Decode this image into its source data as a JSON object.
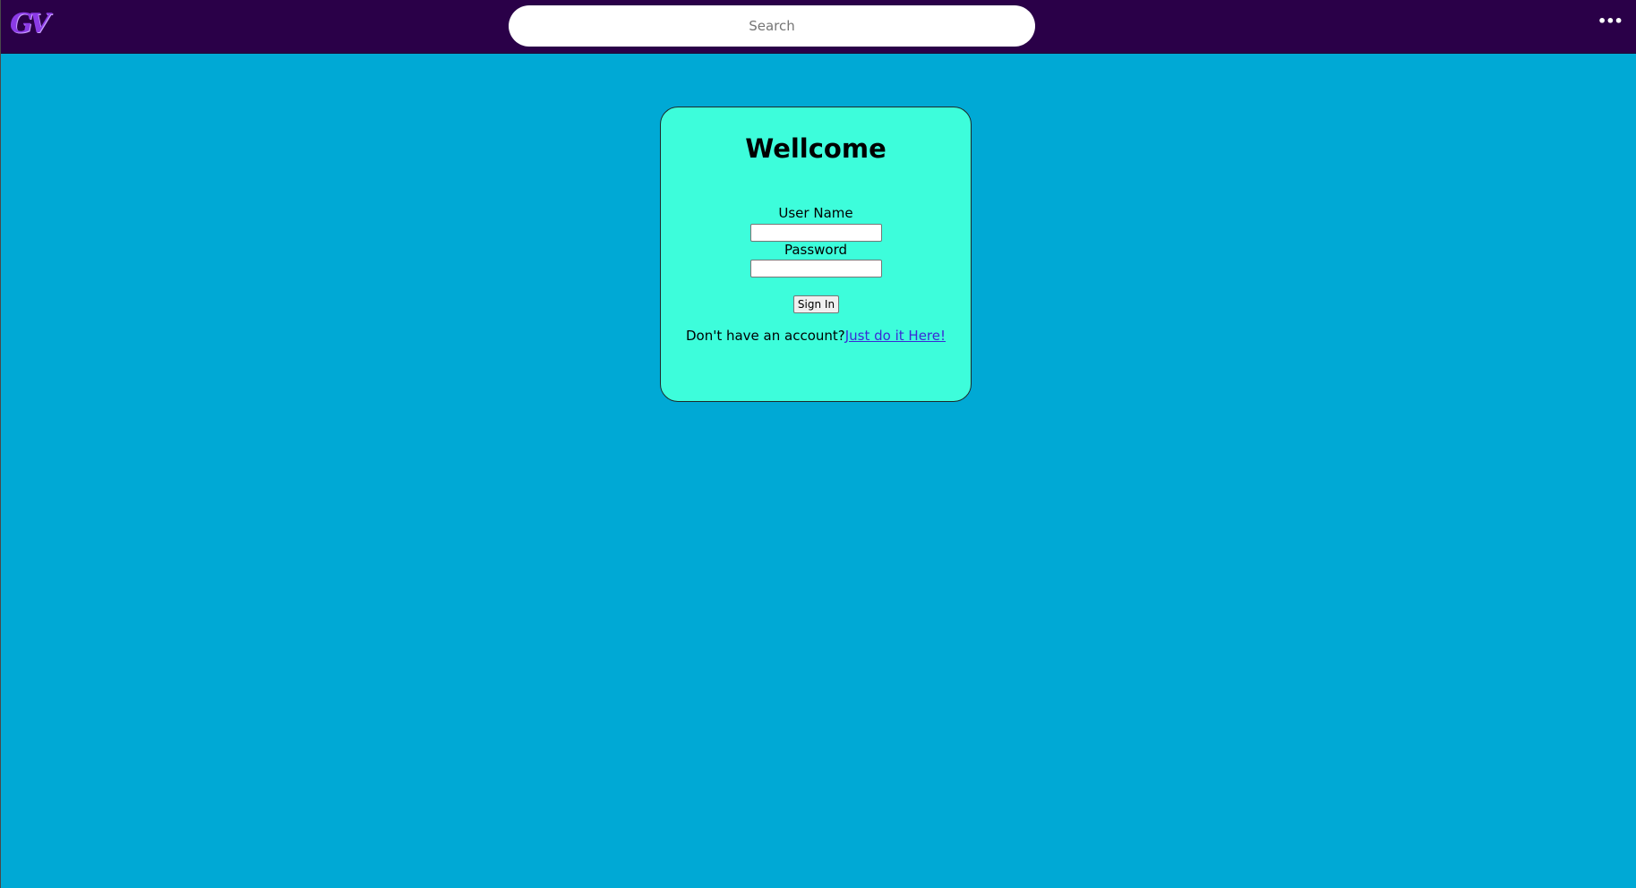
{
  "header": {
    "logo_text": "GV",
    "search": {
      "placeholder": "Search",
      "value": ""
    },
    "menu_label": "•••"
  },
  "login": {
    "title": "Wellcome",
    "username_label": "User Name",
    "username_value": "",
    "password_label": "Password",
    "password_value": "",
    "signin_label": "Sign In",
    "signup_prompt": "Don't have an account?",
    "signup_link": "Just do it Here!"
  },
  "colors": {
    "page_background": "#00a9d5",
    "header_background": "#2a0048",
    "card_background": "#3dfddb",
    "logo": "#8b3ae6",
    "link": "#3b2ad6"
  }
}
